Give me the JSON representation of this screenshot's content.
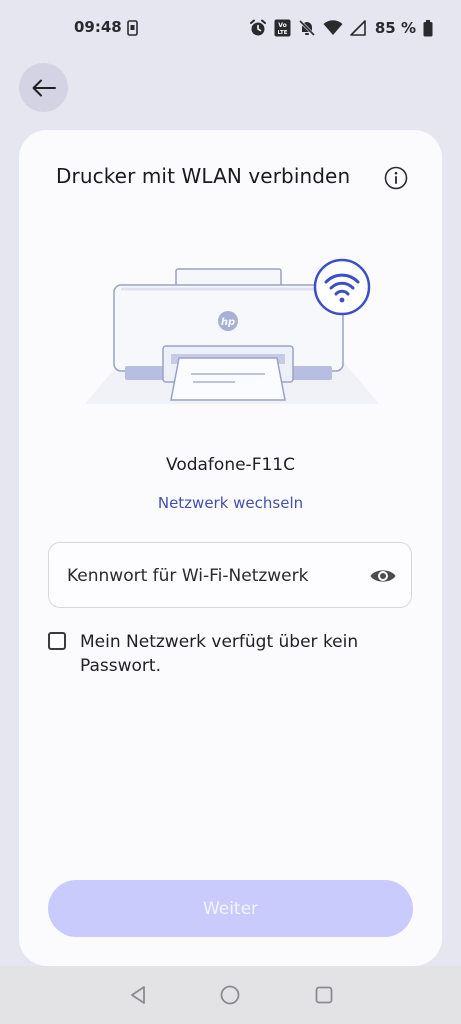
{
  "status_bar": {
    "time": "09:48",
    "battery_percent": "85 %",
    "icons": [
      "sim-icon",
      "alarm-icon",
      "volte-icon",
      "mute-icon",
      "wifi-icon",
      "signal-icon",
      "battery-icon"
    ]
  },
  "header": {
    "back_icon": "arrow-left-icon",
    "title": "Drucker mit WLAN verbinden",
    "info_icon": "info-icon"
  },
  "illustration": {
    "printer_brand": "hp",
    "wifi_badge": "wifi-icon"
  },
  "network": {
    "name": "Vodafone-F11C",
    "change_link": "Netzwerk wechseln"
  },
  "password": {
    "placeholder": "Kennwort für Wi-Fi-Netzwerk",
    "value": "",
    "toggle_icon": "eye-icon"
  },
  "no_password_checkbox": {
    "label": "Mein Netzwerk verfügt über kein Passwort.",
    "checked": false
  },
  "continue_button": {
    "label": "Weiter",
    "enabled": false
  },
  "colors": {
    "background": "#e6e6f1",
    "card": "#fbfbfe",
    "accent": "#4051b0",
    "button_disabled": "#c8cbfb",
    "wifi_badge": "#3d4fc8"
  },
  "nav_bar": {
    "icons": [
      "back-triangle-icon",
      "home-circle-icon",
      "recents-square-icon"
    ]
  }
}
